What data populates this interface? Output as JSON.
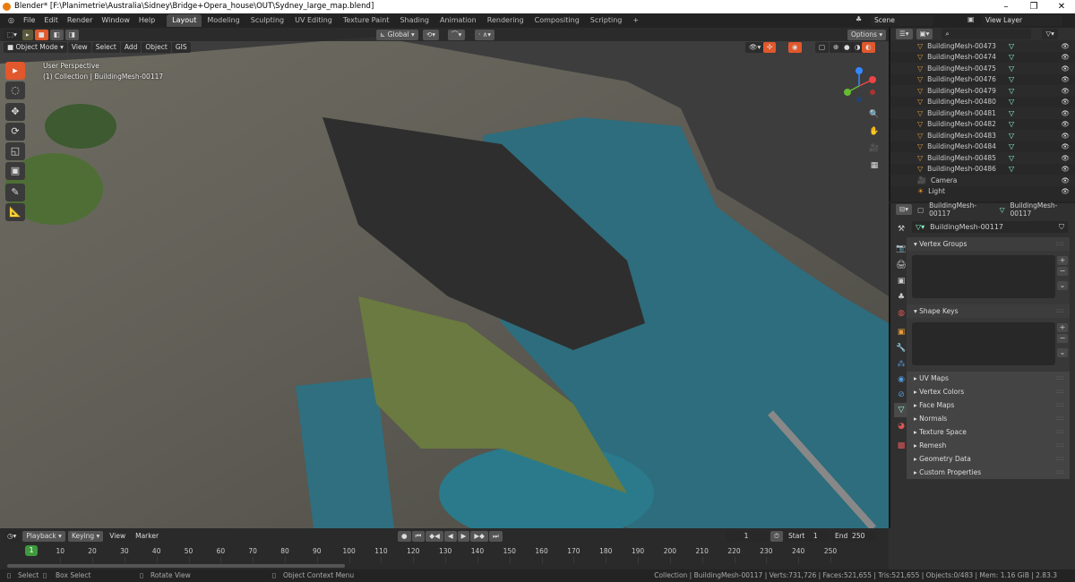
{
  "window": {
    "title": "Blender* [F:\\Planimetrie\\Australia\\Sidney\\Bridge+Opera_house\\OUT\\Sydney_large_map.blend]"
  },
  "menus": [
    "File",
    "Edit",
    "Render",
    "Window",
    "Help"
  ],
  "workspaces": [
    {
      "label": "Layout",
      "active": true
    },
    {
      "label": "Modeling"
    },
    {
      "label": "Sculpting"
    },
    {
      "label": "UV Editing"
    },
    {
      "label": "Texture Paint"
    },
    {
      "label": "Shading"
    },
    {
      "label": "Animation"
    },
    {
      "label": "Rendering"
    },
    {
      "label": "Compositing"
    },
    {
      "label": "Scripting"
    }
  ],
  "scene": {
    "scene": "Scene",
    "view_layer": "View Layer"
  },
  "viewport": {
    "mode": "Object Mode",
    "menus": [
      "View",
      "Select",
      "Add",
      "Object",
      "GIS"
    ],
    "orientation": "Global",
    "options": "Options",
    "overlay_title": "User Perspective",
    "overlay_subtitle": "(1) Collection | BuildingMesh-00117",
    "accent": "#e0582c"
  },
  "outliner": {
    "items": [
      "BuildingMesh-00473",
      "BuildingMesh-00474",
      "BuildingMesh-00475",
      "BuildingMesh-00476",
      "BuildingMesh-00479",
      "BuildingMesh-00480",
      "BuildingMesh-00481",
      "BuildingMesh-00482",
      "BuildingMesh-00483",
      "BuildingMesh-00484",
      "BuildingMesh-00485",
      "BuildingMesh-00486"
    ],
    "camera": "Camera",
    "light": "Light"
  },
  "properties": {
    "object": "BuildingMesh-00117",
    "mesh": "BuildingMesh-00117",
    "datablock": "BuildingMesh-00117",
    "panels_open": [
      "Vertex Groups",
      "Shape Keys"
    ],
    "panels_closed": [
      "UV Maps",
      "Vertex Colors",
      "Face Maps",
      "Normals",
      "Texture Space",
      "Remesh",
      "Geometry Data",
      "Custom Properties"
    ]
  },
  "timeline": {
    "menus": [
      "Playback",
      "Keying",
      "View",
      "Marker"
    ],
    "current_frame": "1",
    "start_label": "Start",
    "start": "1",
    "end_label": "End",
    "end": "250",
    "ticks": [
      "10",
      "20",
      "30",
      "40",
      "50",
      "60",
      "70",
      "80",
      "90",
      "100",
      "110",
      "120",
      "130",
      "140",
      "150",
      "160",
      "170",
      "180",
      "190",
      "200",
      "210",
      "220",
      "230",
      "240",
      "250"
    ],
    "playhead_color": "#3d9a3d"
  },
  "status": {
    "select": "Select",
    "box_select": "Box Select",
    "rotate": "Rotate View",
    "context": "Object Context Menu",
    "info": "Collection | BuildingMesh-00117 | Verts:731,726 | Faces:521,655 | Tris:521,655 | Objects:0/483 | Mem: 1.16 GiB | 2.83.3"
  }
}
